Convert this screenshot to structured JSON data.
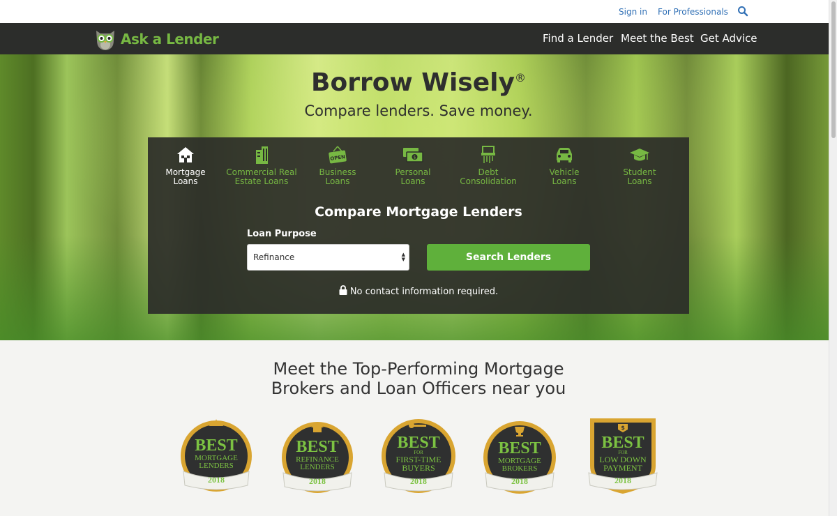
{
  "utility": {
    "sign_in": "Sign in",
    "for_professionals": "For Professionals",
    "search_icon": "search-icon"
  },
  "nav": {
    "logo_text": "Ask a Lender",
    "links": [
      "Find a Lender",
      "Meet the Best",
      "Get Advice"
    ]
  },
  "hero": {
    "title": "Borrow Wisely",
    "title_mark": "®",
    "subtitle": "Compare lenders. Save money."
  },
  "categories": [
    {
      "line1": "Mortgage",
      "line2": "Loans",
      "icon": "house-icon",
      "active": true
    },
    {
      "line1": "Commercial Real",
      "line2": "Estate Loans",
      "icon": "building-icon",
      "active": false
    },
    {
      "line1": "Business",
      "line2": "Loans",
      "icon": "open-sign-icon",
      "active": false
    },
    {
      "line1": "Personal",
      "line2": "Loans",
      "icon": "cash-icon",
      "active": false
    },
    {
      "line1": "Debt",
      "line2": "Consolidation",
      "icon": "shredder-icon",
      "active": false
    },
    {
      "line1": "Vehicle",
      "line2": "Loans",
      "icon": "car-icon",
      "active": false
    },
    {
      "line1": "Student",
      "line2": "Loans",
      "icon": "graduation-cap-icon",
      "active": false
    }
  ],
  "search": {
    "title": "Compare Mortgage Lenders",
    "loan_purpose_label": "Loan Purpose",
    "loan_purpose_value": "Refinance",
    "button": "Search Lenders",
    "note": "No contact information required."
  },
  "lower": {
    "title_line1": "Meet the Top-Performing Mortgage",
    "title_line2": "Brokers and Loan Officers near you"
  },
  "badges": [
    {
      "best": "BEST",
      "for": "",
      "line1": "MORTGAGE",
      "line2": "LENDERS",
      "year": "2018",
      "emblem": "crown-icon"
    },
    {
      "best": "BEST",
      "for": "",
      "line1": "REFINANCE",
      "line2": "LENDERS",
      "year": "2018",
      "emblem": "refinance-house-icon"
    },
    {
      "best": "BEST",
      "for": "FOR",
      "line1": "FIRST-TIME",
      "line2": "BUYERS",
      "year": "2018",
      "emblem": "key-icon"
    },
    {
      "best": "BEST",
      "for": "",
      "line1": "MORTGAGE",
      "line2": "BROKERS",
      "year": "2018",
      "emblem": "trophy-icon"
    },
    {
      "best": "BEST",
      "for": "FOR",
      "line1": "LOW DOWN",
      "line2": "PAYMENT",
      "year": "2018",
      "emblem": "dollar-icon"
    }
  ],
  "colors": {
    "brand_green": "#77b843",
    "button_green": "#5fb03b",
    "nav_dark": "#2c2d2b",
    "link_blue": "#2f6fb5",
    "badge_gold": "#d9a531"
  }
}
